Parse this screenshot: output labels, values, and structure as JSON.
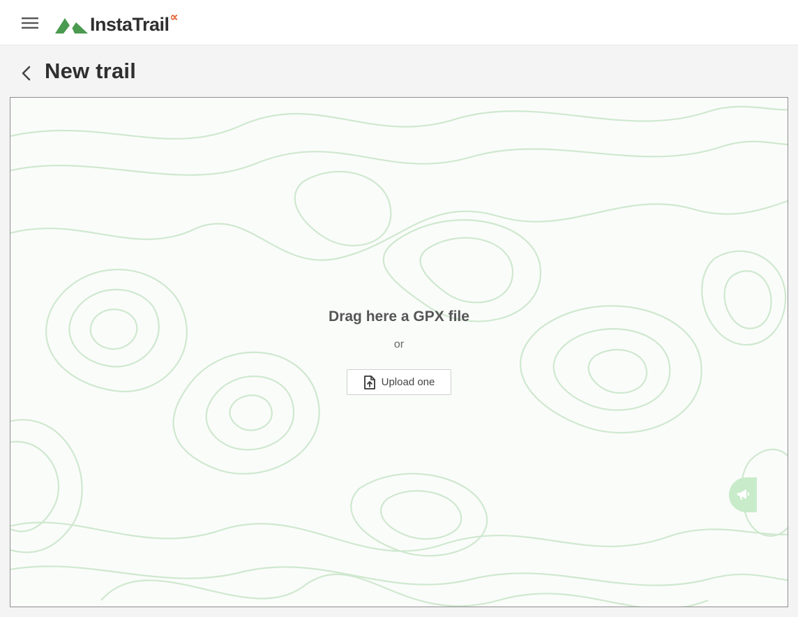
{
  "header": {
    "menu_icon": "hamburger-menu-icon",
    "logo_text": "InstaTrail",
    "logo_alpha": "∝",
    "logo_mark_color": "#4a9a4f",
    "logo_alpha_color": "#e0531e"
  },
  "page": {
    "title": "New trail",
    "back_icon": "chevron-left-icon"
  },
  "dropzone": {
    "title": "Drag here a GPX file",
    "or_text": "or",
    "upload_label": "Upload one",
    "upload_icon": "file-upload-icon",
    "contour_color": "#c9e6c9"
  },
  "feedback": {
    "icon": "megaphone-icon",
    "color": "#c8ebc9"
  }
}
